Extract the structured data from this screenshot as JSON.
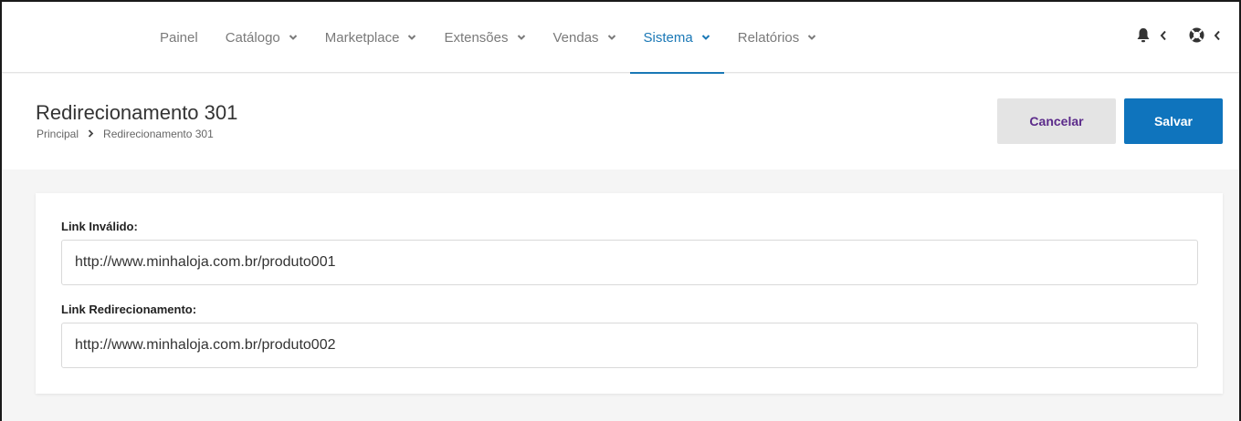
{
  "nav": {
    "items": [
      {
        "label": "Painel",
        "has_menu": false,
        "active": false
      },
      {
        "label": "Catálogo",
        "has_menu": true,
        "active": false
      },
      {
        "label": "Marketplace",
        "has_menu": true,
        "active": false
      },
      {
        "label": "Extensões",
        "has_menu": true,
        "active": false
      },
      {
        "label": "Vendas",
        "has_menu": true,
        "active": false
      },
      {
        "label": "Sistema",
        "has_menu": true,
        "active": true
      },
      {
        "label": "Relatórios",
        "has_menu": true,
        "active": false
      }
    ],
    "icons": [
      "bell-icon",
      "support-icon"
    ]
  },
  "header": {
    "title": "Redirecionamento 301",
    "breadcrumb": [
      "Principal",
      "Redirecionamento 301"
    ],
    "cancel_label": "Cancelar",
    "save_label": "Salvar"
  },
  "form": {
    "invalid_link_label": "Link Inválido:",
    "invalid_link_value": "http://www.minhaloja.com.br/produto001",
    "redirect_link_label": "Link Redirecionamento:",
    "redirect_link_value": "http://www.minhaloja.com.br/produto002"
  },
  "colors": {
    "accent": "#1a78b6",
    "save_button": "#0f74bd",
    "cancel_text": "#5b2a8a"
  }
}
